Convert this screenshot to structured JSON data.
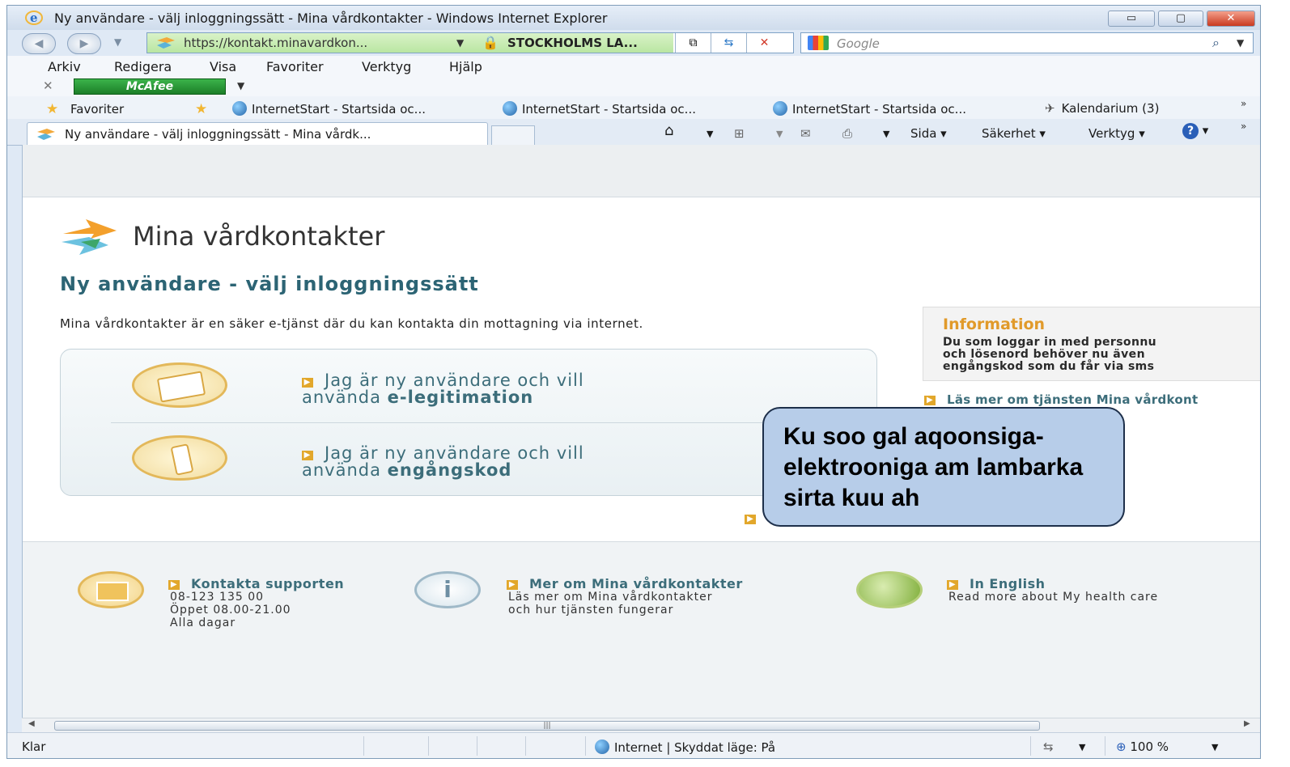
{
  "window": {
    "title": "Ny användare - välj inloggningssätt - Mina vårdkontakter - Windows Internet Explorer"
  },
  "address": {
    "url": "https://kontakt.minavardkon...",
    "certificate": "STOCKHOLMS LA...",
    "search_placeholder": "Google"
  },
  "menu": [
    "Arkiv",
    "Redigera",
    "Visa",
    "Favoriter",
    "Verktyg",
    "Hjälp"
  ],
  "mcafee": {
    "label": "McAfee"
  },
  "favorites": {
    "label": "Favoriter",
    "items": [
      "InternetStart - Startsida oc...",
      "InternetStart - Startsida oc...",
      "InternetStart - Startsida oc...",
      "Kalendarium (3)"
    ]
  },
  "tab": {
    "label": "Ny användare - välj inloggningssätt - Mina vårdk..."
  },
  "commands": {
    "page": "Sida",
    "safety": "Säkerhet",
    "tools": "Verktyg"
  },
  "page": {
    "brand": "Mina vårdkontakter",
    "heading": "Ny användare - välj inloggningssätt",
    "intro": "Mina vårdkontakter är en säker e-tjänst där du kan kontakta din mottagning via internet.",
    "choices": [
      {
        "line1": "Jag är ny användare och vill",
        "line2_prefix": "använda ",
        "line2_bold": "e-legitimation"
      },
      {
        "line1": "Jag är ny användare och vill",
        "line2_prefix": "använda ",
        "line2_bold": "engångskod"
      }
    ],
    "info": {
      "title": "Information",
      "text": "Du som loggar in med personnu\noch lösenord behöver nu även \nengångskod som du får via sms",
      "link": "Läs mer om tjänsten Mina vårdkont"
    },
    "callout": "Ku soo gal aqoonsiga-elektrooniga am lambarka sirta kuu ah",
    "footer": {
      "support": {
        "title": "Kontakta supporten",
        "lines": [
          "08-123 135 00",
          "Öppet 08.00-21.00",
          "Alla dagar"
        ]
      },
      "more": {
        "title": "Mer om Mina vårdkontakter",
        "lines": [
          "Läs mer om Mina vårdkontakter",
          "och hur tjänsten fungerar"
        ]
      },
      "english": {
        "title": "In English",
        "lines": [
          "Read more about My health care"
        ]
      }
    }
  },
  "status": {
    "left": "Klar",
    "zone": "Internet | Skyddat läge: På",
    "zoom": "100 %"
  }
}
